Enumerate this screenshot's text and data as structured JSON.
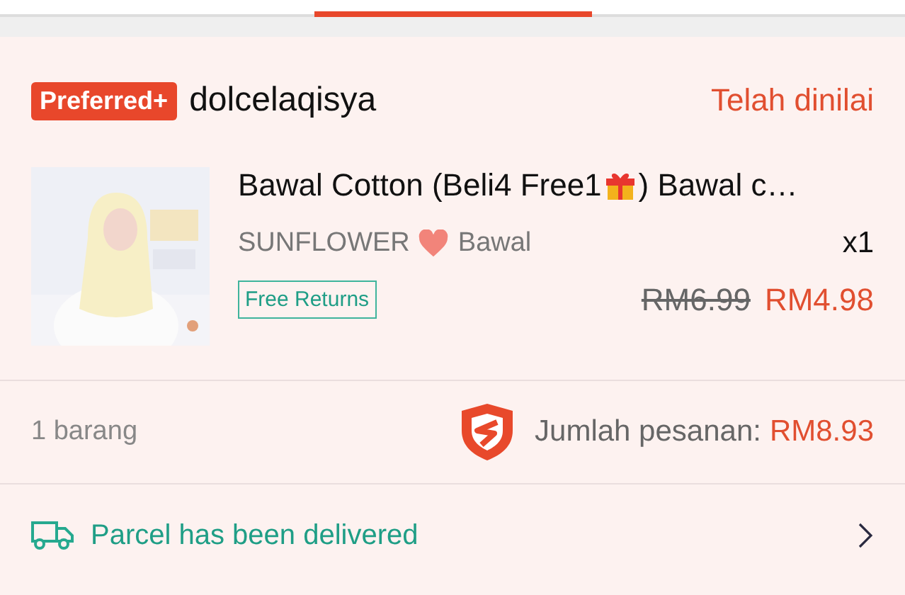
{
  "shop": {
    "badge": "Preferred+",
    "name": "dolcelaqisya",
    "status": "Telah dinilai"
  },
  "product": {
    "title_before": "Bawal Cotton (Beli4 Free1",
    "title_after": ") Bawal c…",
    "variation_before": "SUNFLOWER",
    "variation_after": "Bawal",
    "quantity": "x1",
    "tag": "Free Returns",
    "original_price": "RM6.99",
    "price": "RM4.98"
  },
  "summary": {
    "items": "1 barang",
    "total_label": "Jumlah pesanan:",
    "total": "RM8.93"
  },
  "delivery": {
    "status": "Parcel has been delivered"
  }
}
